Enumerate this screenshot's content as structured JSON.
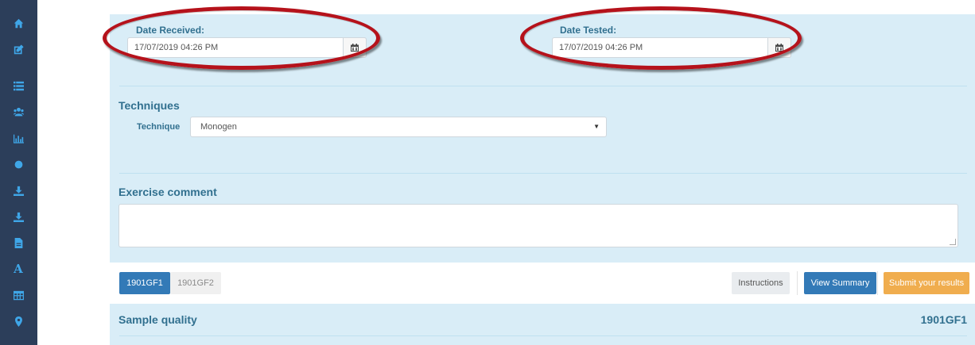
{
  "sidebar": {
    "items": [
      {
        "icon": "home-icon"
      },
      {
        "icon": "edit-icon"
      },
      {
        "icon": "list-icon"
      },
      {
        "icon": "users-icon"
      },
      {
        "icon": "bar-chart-icon"
      },
      {
        "icon": "circle-icon"
      },
      {
        "icon": "download-icon"
      },
      {
        "icon": "download-icon"
      },
      {
        "icon": "file-icon"
      },
      {
        "icon": "font-icon",
        "glyph": "A"
      },
      {
        "icon": "table-icon"
      },
      {
        "icon": "map-marker-icon"
      }
    ]
  },
  "dates": {
    "received_label": "Date Received:",
    "received_value": "17/07/2019 04:26 PM",
    "tested_label": "Date Tested:",
    "tested_value": "17/07/2019 04:26 PM"
  },
  "techniques": {
    "title": "Techniques",
    "field_label": "Technique",
    "selected": "Monogen"
  },
  "comment": {
    "title": "Exercise comment",
    "value": ""
  },
  "toolbar": {
    "tabs": [
      {
        "label": "1901GF1",
        "active": true
      },
      {
        "label": "1901GF2",
        "active": false
      }
    ],
    "instructions_label": "Instructions",
    "view_summary_label": "View Summary",
    "submit_label": "Submit your results"
  },
  "sample": {
    "title": "Sample quality",
    "code": "1901GF1"
  },
  "colors": {
    "sidebar_bg": "#2c3e5a",
    "sidebar_icon": "#3fa6e8",
    "panel_bg": "#d9edf7",
    "heading": "#31708f",
    "primary": "#337ab7",
    "warning": "#f0ad4e",
    "annotation_ellipse": "#b5121b"
  }
}
